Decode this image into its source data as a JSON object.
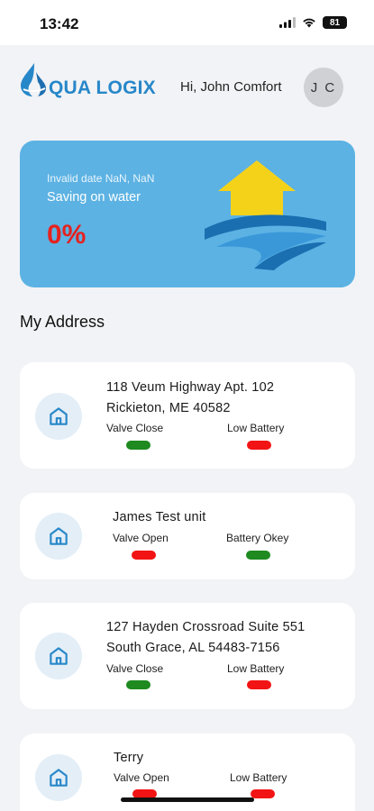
{
  "status_bar": {
    "time": "13:42",
    "battery": "81"
  },
  "header": {
    "logo_text": "QUA LOGIX",
    "greeting": "Hi, John Comfort",
    "avatar_initials": "J C"
  },
  "hero": {
    "date": "Invalid date NaN, NaN",
    "label": "Saving on water",
    "value": "0%"
  },
  "section_title": "My Address",
  "addresses": [
    {
      "line1": "118 Veum Highway Apt. 102",
      "line2": "Rickieton, ME 40582",
      "valve_label": "Valve Close",
      "valve_status": "ok",
      "battery_label": "Low Battery",
      "battery_status": "alert"
    },
    {
      "line1": "James Test unit",
      "line2": "",
      "valve_label": "Valve Open",
      "valve_status": "alert",
      "battery_label": "Battery Okey",
      "battery_status": "ok"
    },
    {
      "line1": "127 Hayden Crossroad Suite 551",
      "line2": "South Grace, AL 54483-7156",
      "valve_label": "Valve Close",
      "valve_status": "ok",
      "battery_label": "Low Battery",
      "battery_status": "alert"
    },
    {
      "line1": "Terry",
      "line2": "",
      "valve_label": "Valve Open",
      "valve_status": "alert",
      "battery_label": "Low Battery",
      "battery_status": "alert"
    }
  ],
  "colors": {
    "accent": "#2787c9",
    "hero_bg": "#5cb2e3",
    "status_ok": "#1e8a20",
    "status_alert": "#f21414"
  },
  "icons": {
    "card_icon": "home-icon",
    "hero_art": "house-water-icon",
    "logo": "water-drop-icon"
  }
}
